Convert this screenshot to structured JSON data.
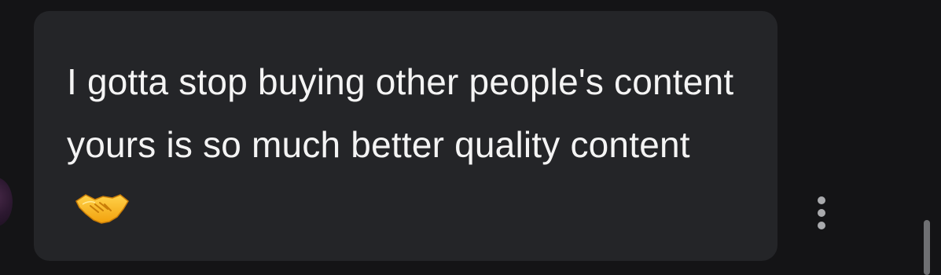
{
  "message": {
    "text": "I gotta stop buying other people's content yours is so much better quality content",
    "emoji": "handshake-icon"
  },
  "colors": {
    "background": "#141416",
    "bubble": "#242528",
    "text": "#f4f4f4",
    "menu_dots": "#a9aaad",
    "scrollbar": "#6f7073"
  }
}
